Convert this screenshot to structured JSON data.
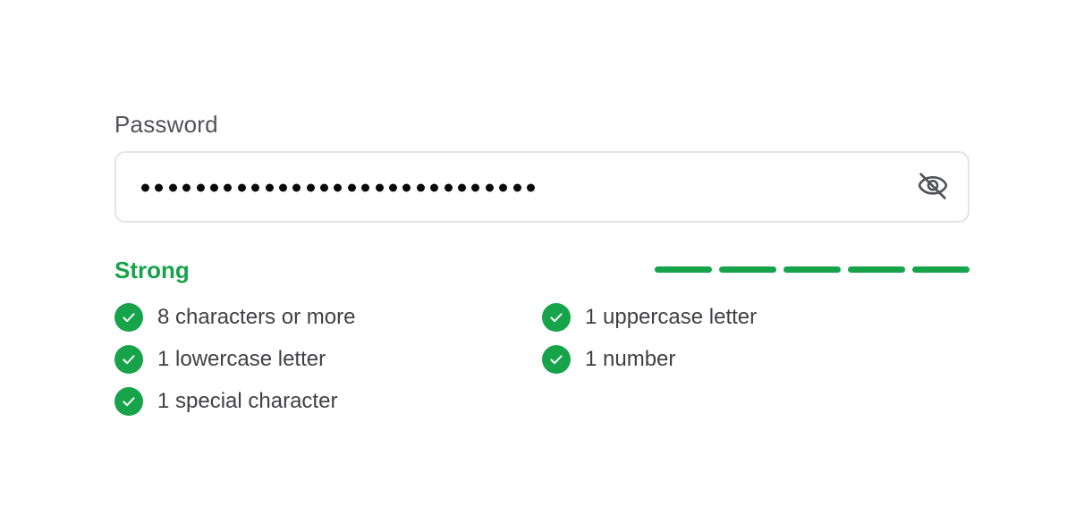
{
  "password": {
    "label": "Password",
    "masked_length": 29,
    "toggle_icon": "eye-off-icon"
  },
  "strength": {
    "label": "Strong",
    "filled_segments": 5,
    "total_segments": 5,
    "color": "#16a34a"
  },
  "requirements": [
    {
      "text": "8 characters or more",
      "met": true
    },
    {
      "text": "1 uppercase letter",
      "met": true
    },
    {
      "text": "1 lowercase letter",
      "met": true
    },
    {
      "text": "1 number",
      "met": true
    },
    {
      "text": "1 special character",
      "met": true
    }
  ],
  "colors": {
    "success": "#16a34a",
    "label": "#52525b",
    "text": "#3f3f46",
    "border": "#e4e4e7",
    "icon": "#52525b"
  }
}
